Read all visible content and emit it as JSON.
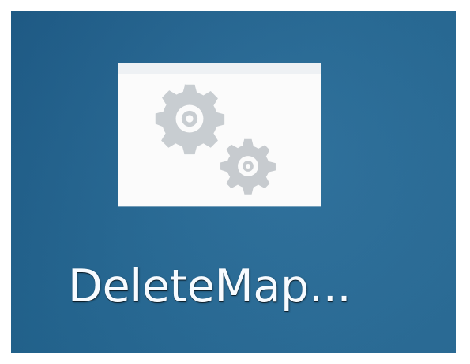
{
  "desktop": {
    "background_color": "#246996",
    "icon": {
      "label": "DeleteMap...",
      "thumbnail_icon_name": "gears-icon",
      "thumbnail_background": "#fbfbfb"
    }
  }
}
